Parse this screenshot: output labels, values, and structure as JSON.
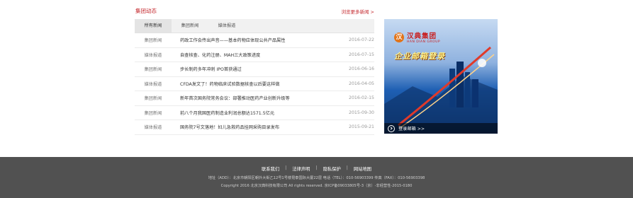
{
  "news": {
    "title": "集团动态",
    "more": "浏览更多新闻 >",
    "tabs": [
      "所有新闻",
      "集团新闻",
      "媒体报道"
    ],
    "items": [
      {
        "category": "集团新闻",
        "title": "药政工作会传出声音——基本药物应体现公共产品属性",
        "date": "2016-07-22"
      },
      {
        "category": "媒体报道",
        "title": "自查核查、化药注册、MAH三大政策进度",
        "date": "2016-07-15"
      },
      {
        "category": "集团新闻",
        "title": "步长制药多年冲刺 IPO首获通过",
        "date": "2016-06-16"
      },
      {
        "category": "媒体报道",
        "title": "CFDA发文了！药物临床试验数据核查以后要这样做",
        "date": "2016-04-05"
      },
      {
        "category": "集团新闻",
        "title": "新年首次国务院常务会议：部署推动医药产业创新升级等",
        "date": "2016-02-15"
      },
      {
        "category": "集团新闻",
        "title": "前八个月我国医药制造业利润总额达1571.5亿元",
        "date": "2015-09-30"
      },
      {
        "category": "媒体报道",
        "title": "国务院7号文落地！妇儿急救药品挂网采购目录发布",
        "date": "2015-09-21"
      }
    ]
  },
  "banner": {
    "logo_mark": "汉",
    "logo_cn": "汉典集团",
    "logo_en": "HAN DIAN GROUP",
    "title": "企业邮箱登录",
    "login_label": "登录邮箱 >>",
    "icon": "mail-icon"
  },
  "footer": {
    "links": [
      "联系我们",
      "法律声明",
      "隐私保护",
      "网站地图"
    ],
    "address": "地址（ADD）：北京市朝阳区朝外大街乙12号1号楼昆泰国际大厦22层   电话（TEL）：010-56903399   传真（FAX）：010-56903398",
    "copyright": "Copyright 2016 北京汉典科技有限公司 All rights reserved.   京ICP备09033805号-3（京）-非经营性-2015-0180"
  },
  "colors": {
    "accent": "#c4272c",
    "footer_bg": "#515151"
  }
}
